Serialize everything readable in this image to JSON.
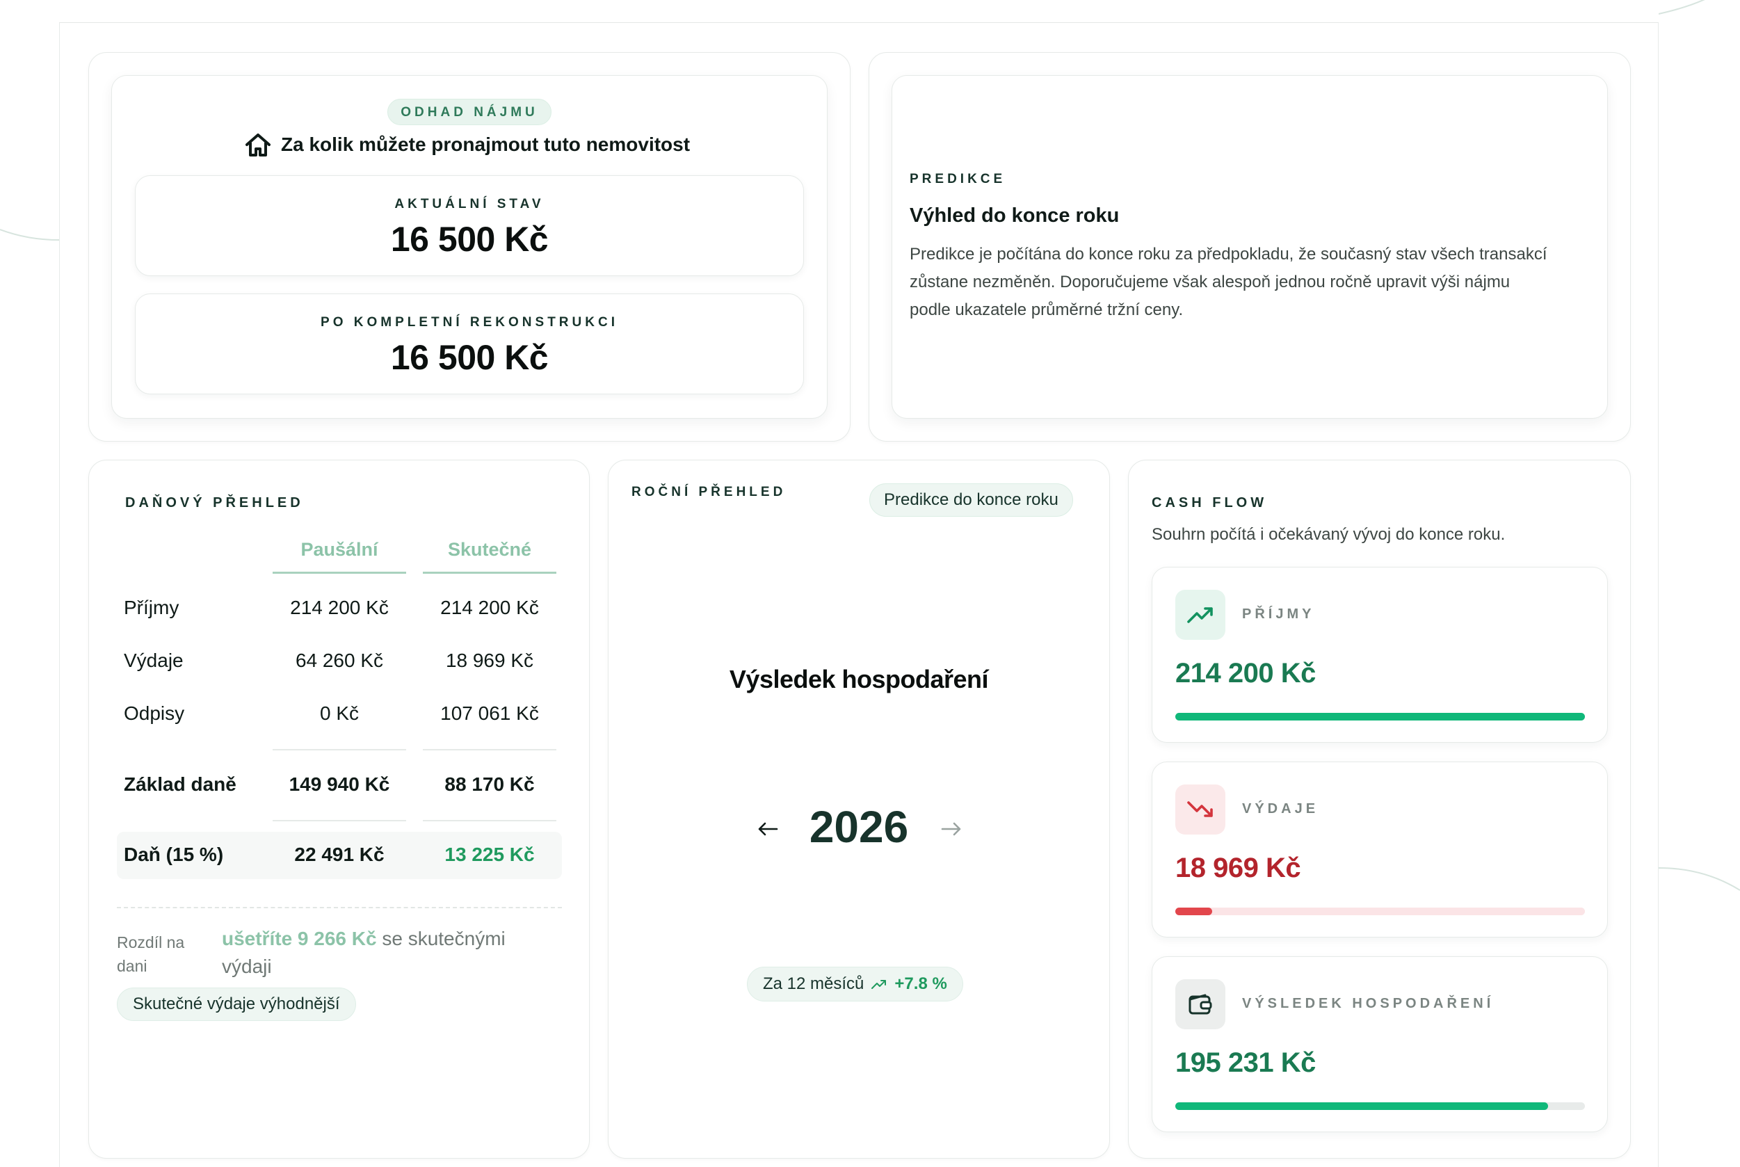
{
  "rent": {
    "badge": "ODHAD NÁJMU",
    "title": "Za kolik můžete pronajmout tuto nemovitost",
    "current_label": "AKTUÁLNÍ STAV",
    "current_value": "16 500 Kč",
    "reno_label": "PO KOMPLETNÍ REKONSTRUKCI",
    "reno_value": "16 500 Kč"
  },
  "prediction": {
    "eyebrow": "PREDIKCE",
    "title": "Výhled do konce roku",
    "line1": "Predikce je počítána do konce roku za předpokladu, že současný stav všech transakcí",
    "line2": "zůstane nezměněn. Doporučujeme však alespoň jednou ročně upravit výši nájmu",
    "line3": "podle ukazatele průměrné tržní ceny."
  },
  "tax": {
    "eyebrow": "DAŇOVÝ PŘEHLED",
    "col1": "Paušální",
    "col2": "Skutečné",
    "rows": [
      {
        "label": "Příjmy",
        "a": "214 200 Kč",
        "b": "214 200 Kč"
      },
      {
        "label": "Výdaje",
        "a": "64 260 Kč",
        "b": "18 969 Kč"
      },
      {
        "label": "Odpisy",
        "a": "0 Kč",
        "b": "107 061 Kč"
      },
      {
        "label": "Základ daně",
        "a": "149 940 Kč",
        "b": "88 170 Kč"
      },
      {
        "label": "Daň (15 %)",
        "a": "22 491 Kč",
        "b": "13 225 Kč"
      }
    ],
    "diff_label_1": "Rozdíl na",
    "diff_label_2": "dani",
    "diff_highlight": "ušetříte 9 266 Kč",
    "diff_rest": " se skutečnými",
    "diff_rest2": "výdaji",
    "verdict": "Skutečné výdaje výhodnější"
  },
  "annual": {
    "eyebrow": "ROČNÍ PŘEHLED",
    "badge": "Predikce do konce roku",
    "title": "Výsledek hospodaření",
    "year": "2026",
    "period": "Za 12 měsíců",
    "change": "+7.8 %"
  },
  "cashflow": {
    "eyebrow": "CASH FLOW",
    "subtitle": "Souhrn počítá i očekávaný vývoj do konce roku.",
    "items": [
      {
        "label": "PŘÍJMY",
        "value": "214 200 Kč",
        "icon": "trending-up-icon",
        "color": "#1a7a52",
        "fill": 1.0
      },
      {
        "label": "VÝDAJE",
        "value": "18 969 Kč",
        "icon": "trending-down-icon",
        "color": "#b3242c",
        "fill": 0.09
      },
      {
        "label": "VÝSLEDEK HOSPODAŘENÍ",
        "value": "195 231 Kč",
        "icon": "wallet-icon",
        "color": "#1a7a52",
        "fill": 0.91
      }
    ]
  },
  "colors": {
    "accent_green": "#10b87a",
    "accent_red": "#e2464c",
    "dark_text": "#0f1a17",
    "teal_dark": "#17332b"
  }
}
